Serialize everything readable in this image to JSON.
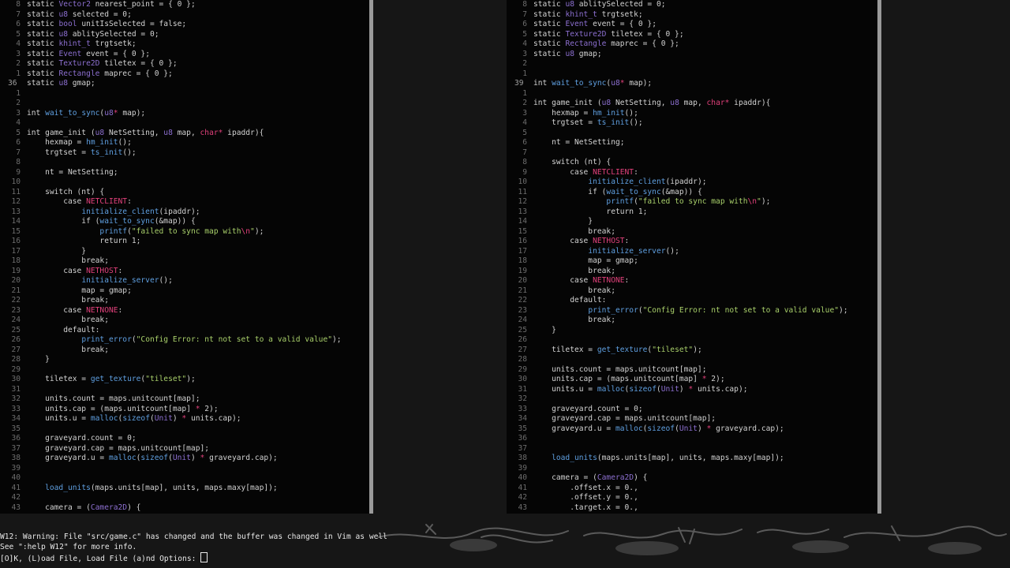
{
  "colors": {
    "background": "#050505",
    "type": "#8c6fd0",
    "constant": "#e0407a",
    "string": "#a8cf6a",
    "function": "#5f9fe0",
    "line_number": "#6d6d6d"
  },
  "left_pane": {
    "lines": [
      {
        "n": "8",
        "t": "static Vector2 nearest_point = { 0 };"
      },
      {
        "n": "7",
        "t": "static u8 selected = 0;"
      },
      {
        "n": "6",
        "t": "static bool unitIsSelected = false;"
      },
      {
        "n": "5",
        "t": "static u8 ablitySelected = 0;"
      },
      {
        "n": "4",
        "t": "static khint_t trgtsetk;"
      },
      {
        "n": "3",
        "t": "static Event event = { 0 };"
      },
      {
        "n": "2",
        "t": "static Texture2D tiletex = { 0 };"
      },
      {
        "n": "1",
        "t": "static Rectangle maprec = { 0 };"
      },
      {
        "n": "36",
        "t": "static u8 gmap;",
        "cur": true
      },
      {
        "n": "1",
        "t": ""
      },
      {
        "n": "2",
        "t": ""
      },
      {
        "n": "3",
        "t": "int wait_to_sync(u8* map);"
      },
      {
        "n": "4",
        "t": ""
      },
      {
        "n": "5",
        "t": "int game_init (u8 NetSetting, u8 map, char* ipaddr){"
      },
      {
        "n": "6",
        "t": "    hexmap = hm_init();"
      },
      {
        "n": "7",
        "t": "    trgtset = ts_init();"
      },
      {
        "n": "8",
        "t": ""
      },
      {
        "n": "9",
        "t": "    nt = NetSetting;"
      },
      {
        "n": "10",
        "t": ""
      },
      {
        "n": "11",
        "t": "    switch (nt) {"
      },
      {
        "n": "12",
        "t": "        case NETCLIENT:"
      },
      {
        "n": "13",
        "t": "            initialize_client(ipaddr);"
      },
      {
        "n": "14",
        "t": "            if (wait_to_sync(&map)) {"
      },
      {
        "n": "15",
        "t": "                printf(\"failed to sync map with\\n\");"
      },
      {
        "n": "16",
        "t": "                return 1;"
      },
      {
        "n": "17",
        "t": "            }"
      },
      {
        "n": "18",
        "t": "            break;"
      },
      {
        "n": "19",
        "t": "        case NETHOST:"
      },
      {
        "n": "20",
        "t": "            initialize_server();"
      },
      {
        "n": "21",
        "t": "            map = gmap;"
      },
      {
        "n": "22",
        "t": "            break;"
      },
      {
        "n": "23",
        "t": "        case NETNONE:"
      },
      {
        "n": "24",
        "t": "            break;"
      },
      {
        "n": "25",
        "t": "        default:"
      },
      {
        "n": "26",
        "t": "            print_error(\"Config Error: nt not set to a valid value\");"
      },
      {
        "n": "27",
        "t": "            break;"
      },
      {
        "n": "28",
        "t": "    }"
      },
      {
        "n": "29",
        "t": ""
      },
      {
        "n": "30",
        "t": "    tiletex = get_texture(\"tileset\");"
      },
      {
        "n": "31",
        "t": ""
      },
      {
        "n": "32",
        "t": "    units.count = maps.unitcount[map];"
      },
      {
        "n": "33",
        "t": "    units.cap = (maps.unitcount[map] * 2);"
      },
      {
        "n": "34",
        "t": "    units.u = malloc(sizeof(Unit) * units.cap);"
      },
      {
        "n": "35",
        "t": ""
      },
      {
        "n": "36",
        "t": "    graveyard.count = 0;"
      },
      {
        "n": "37",
        "t": "    graveyard.cap = maps.unitcount[map];"
      },
      {
        "n": "38",
        "t": "    graveyard.u = malloc(sizeof(Unit) * graveyard.cap);"
      },
      {
        "n": "39",
        "t": ""
      },
      {
        "n": "40",
        "t": ""
      },
      {
        "n": "41",
        "t": "    load_units(maps.units[map], units, maps.maxy[map]);"
      },
      {
        "n": "42",
        "t": ""
      },
      {
        "n": "43",
        "t": "    camera = (Camera2D) {"
      }
    ]
  },
  "right_pane": {
    "lines": [
      {
        "n": "8",
        "t": "static u8 ablitySelected = 0;"
      },
      {
        "n": "7",
        "t": "static khint_t trgtsetk;"
      },
      {
        "n": "6",
        "t": "static Event event = { 0 };"
      },
      {
        "n": "5",
        "t": "static Texture2D tiletex = { 0 };"
      },
      {
        "n": "4",
        "t": "static Rectangle maprec = { 0 };"
      },
      {
        "n": "3",
        "t": "static u8 gmap;"
      },
      {
        "n": "2",
        "t": ""
      },
      {
        "n": "1",
        "t": ""
      },
      {
        "n": "39",
        "t": "int wait_to_sync(u8* map);",
        "cur": true
      },
      {
        "n": "1",
        "t": ""
      },
      {
        "n": "2",
        "t": "int game_init (u8 NetSetting, u8 map, char* ipaddr){"
      },
      {
        "n": "3",
        "t": "    hexmap = hm_init();"
      },
      {
        "n": "4",
        "t": "    trgtset = ts_init();"
      },
      {
        "n": "5",
        "t": ""
      },
      {
        "n": "6",
        "t": "    nt = NetSetting;"
      },
      {
        "n": "7",
        "t": ""
      },
      {
        "n": "8",
        "t": "    switch (nt) {"
      },
      {
        "n": "9",
        "t": "        case NETCLIENT:"
      },
      {
        "n": "10",
        "t": "            initialize_client(ipaddr);"
      },
      {
        "n": "11",
        "t": "            if (wait_to_sync(&map)) {"
      },
      {
        "n": "12",
        "t": "                printf(\"failed to sync map with\\n\");"
      },
      {
        "n": "13",
        "t": "                return 1;"
      },
      {
        "n": "14",
        "t": "            }"
      },
      {
        "n": "15",
        "t": "            break;"
      },
      {
        "n": "16",
        "t": "        case NETHOST:"
      },
      {
        "n": "17",
        "t": "            initialize_server();"
      },
      {
        "n": "18",
        "t": "            map = gmap;"
      },
      {
        "n": "19",
        "t": "            break;"
      },
      {
        "n": "20",
        "t": "        case NETNONE:"
      },
      {
        "n": "21",
        "t": "            break;"
      },
      {
        "n": "22",
        "t": "        default:"
      },
      {
        "n": "23",
        "t": "            print_error(\"Config Error: nt not set to a valid value\");"
      },
      {
        "n": "24",
        "t": "            break;"
      },
      {
        "n": "25",
        "t": "    }"
      },
      {
        "n": "26",
        "t": ""
      },
      {
        "n": "27",
        "t": "    tiletex = get_texture(\"tileset\");"
      },
      {
        "n": "28",
        "t": ""
      },
      {
        "n": "29",
        "t": "    units.count = maps.unitcount[map];"
      },
      {
        "n": "30",
        "t": "    units.cap = (maps.unitcount[map] * 2);"
      },
      {
        "n": "31",
        "t": "    units.u = malloc(sizeof(Unit) * units.cap);"
      },
      {
        "n": "32",
        "t": ""
      },
      {
        "n": "33",
        "t": "    graveyard.count = 0;"
      },
      {
        "n": "34",
        "t": "    graveyard.cap = maps.unitcount[map];"
      },
      {
        "n": "35",
        "t": "    graveyard.u = malloc(sizeof(Unit) * graveyard.cap);"
      },
      {
        "n": "36",
        "t": ""
      },
      {
        "n": "37",
        "t": ""
      },
      {
        "n": "38",
        "t": "    load_units(maps.units[map], units, maps.maxy[map]);"
      },
      {
        "n": "39",
        "t": ""
      },
      {
        "n": "40",
        "t": "    camera = (Camera2D) {"
      },
      {
        "n": "41",
        "t": "        .offset.x = 0.,"
      },
      {
        "n": "42",
        "t": "        .offset.y = 0.,"
      },
      {
        "n": "43",
        "t": "        .target.x = 0.,"
      }
    ]
  },
  "command_line": {
    "warning": "W12: Warning: File \"src/game.c\" has changed and the buffer was changed in Vim as well",
    "help": "See \":help W12\" for more info.",
    "prompt": "[O]K, (L)oad File, Load File (a)nd Options: "
  }
}
